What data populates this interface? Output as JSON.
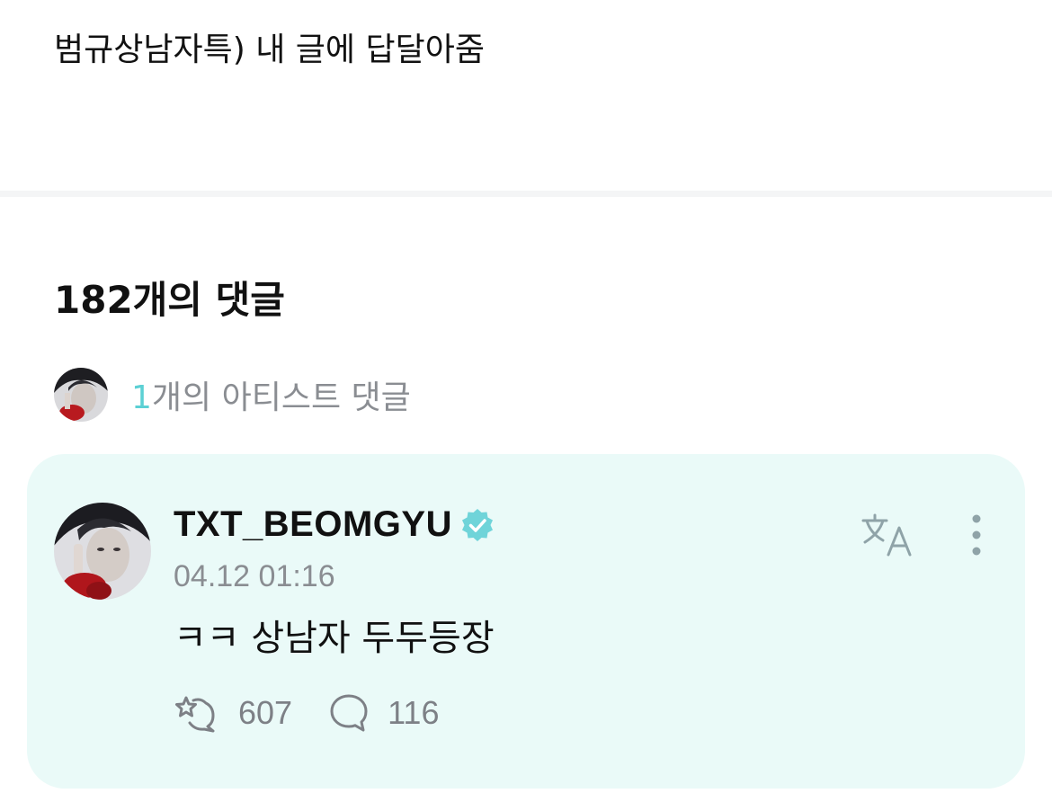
{
  "post": {
    "title": "범규상남자특) 내 글에 답달아줌"
  },
  "comments": {
    "header": "182개의 댓글",
    "artist_summary": {
      "count": "1",
      "label": "개의 아티스트 댓글"
    }
  },
  "artist_comment": {
    "author": "TXT_BEOMGYU",
    "timestamp": "04.12 01:16",
    "text": "ㅋㅋ 상남자 두두등장",
    "like_count": "607",
    "reply_count": "116"
  },
  "colors": {
    "accent": "#5cd0d4",
    "card_background": "#eafaf8",
    "muted_text": "#8a8d92"
  },
  "icons": {
    "verified": "verified-badge-icon",
    "translate": "translate-icon",
    "more": "more-vertical-icon",
    "like": "like-reaction-icon",
    "reply": "speech-bubble-icon"
  }
}
